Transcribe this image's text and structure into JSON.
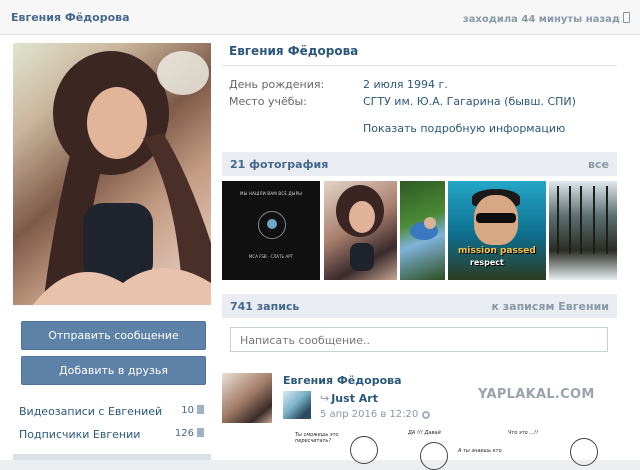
{
  "header": {
    "name": "Евгения Фёдорова",
    "last_seen": "заходила 44 минуты назад"
  },
  "profile": {
    "name": "Евгения Фёдорова",
    "rows": [
      {
        "label": "День рождения:",
        "value": "2 июля 1994 г."
      },
      {
        "label": "Место учёбы:",
        "value": "СГТУ им. Ю.А. Гагарина (бывш. СПИ)"
      }
    ],
    "more_info": "Показать подробную информацию"
  },
  "actions": {
    "send_message": "Отправить сообщение",
    "add_friend": "Добавить в друзья"
  },
  "side_links": [
    {
      "label": "Видеозаписи с Евгенией",
      "count": "10"
    },
    {
      "label": "Подписчики Евгении",
      "count": "126"
    }
  ],
  "photos": {
    "title": "21 фотография",
    "all_link": "все",
    "thumb1_caption": "МЫ НАШЛИ ВАМ ВСЕ ДЫРЫ",
    "thumb1_bottom": "МСА FSB · СЛАТЬ АРТ",
    "thumb4_text1": "mission passed",
    "thumb4_text2": "respect"
  },
  "wall": {
    "title": "741 запись",
    "all_link": "к записям Евгении",
    "placeholder": "Написать сообщение.."
  },
  "post": {
    "author": "Евгения Фёдорова",
    "repost_from": "Just Art",
    "date": "5 апр 2016 в 12:20",
    "comic_lines": [
      "Ты сможешь это пересчитать?",
      "ДА !!! Давай",
      "Что это ...!!",
      "А ты знаешь кто"
    ]
  },
  "watermark": "YAPLAKAL.COM",
  "colors": {
    "link": "#2b587a",
    "button": "#5e81a8",
    "header_bg": "#e9edf1"
  }
}
